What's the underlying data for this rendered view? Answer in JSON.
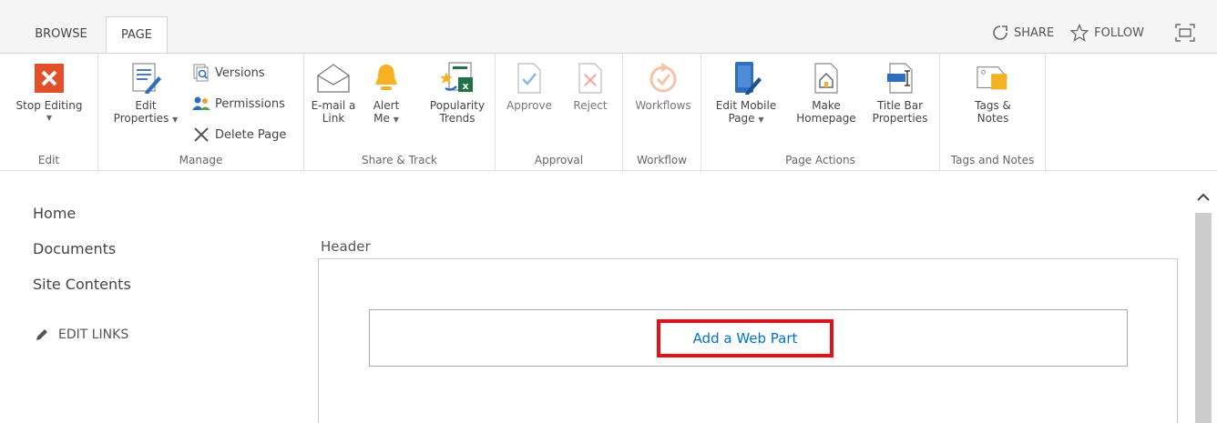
{
  "tabs": [
    {
      "label": "BROWSE",
      "active": false
    },
    {
      "label": "PAGE",
      "active": true
    }
  ],
  "top_actions": {
    "share": "SHARE",
    "follow": "FOLLOW"
  },
  "ribbon": {
    "edit_group": {
      "label": "Edit",
      "stop_editing": "Stop Editing"
    },
    "manage_group": {
      "label": "Manage",
      "edit_properties_line1": "Edit",
      "edit_properties_line2": "Properties",
      "versions": "Versions",
      "permissions": "Permissions",
      "delete_page": "Delete Page"
    },
    "share_group": {
      "label": "Share & Track",
      "email_line1": "E-mail a",
      "email_line2": "Link",
      "alert_line1": "Alert",
      "alert_line2": "Me",
      "popularity_line1": "Popularity",
      "popularity_line2": "Trends"
    },
    "approval_group": {
      "label": "Approval",
      "approve": "Approve",
      "reject": "Reject"
    },
    "workflow_group": {
      "label": "Workflow",
      "workflows": "Workflows"
    },
    "page_actions_group": {
      "label": "Page Actions",
      "edit_mobile_line1": "Edit Mobile",
      "edit_mobile_line2": "Page",
      "make_homepage_line1": "Make",
      "make_homepage_line2": "Homepage",
      "title_bar_line1": "Title Bar",
      "title_bar_line2": "Properties"
    },
    "tags_group": {
      "label": "Tags and Notes",
      "tags_line1": "Tags &",
      "tags_line2": "Notes"
    }
  },
  "nav": {
    "items": [
      "Home",
      "Documents",
      "Site Contents"
    ],
    "edit_links": "EDIT LINKS"
  },
  "content": {
    "zone_title": "Header",
    "add_web_part": "Add a Web Part"
  },
  "colors": {
    "accent_link": "#0072c6",
    "highlight_border": "#e3111a",
    "stop_editing_icon": "#e0502a"
  }
}
